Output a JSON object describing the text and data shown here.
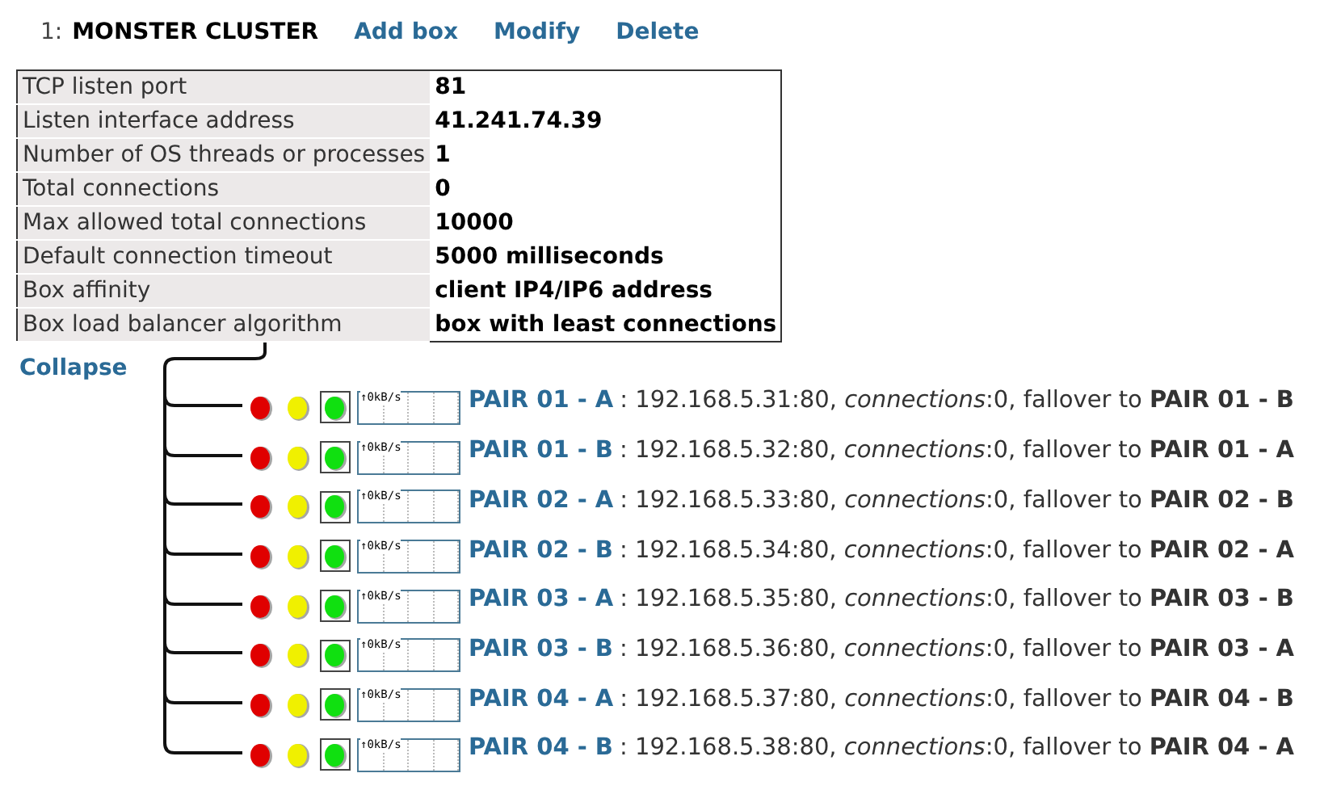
{
  "cluster": {
    "index": "1:",
    "name": "MONSTER CLUSTER",
    "actions": [
      "Add box",
      "Modify",
      "Delete"
    ]
  },
  "properties": [
    {
      "label": "TCP listen port",
      "value": "81"
    },
    {
      "label": "Listen interface address",
      "value": "41.241.74.39"
    },
    {
      "label": "Number of OS threads or processes",
      "value": "1"
    },
    {
      "label": "Total connections",
      "value": "0"
    },
    {
      "label": "Max allowed total connections",
      "value": "10000"
    },
    {
      "label": "Default connection timeout",
      "value": "5000 milliseconds"
    },
    {
      "label": "Box affinity",
      "value": "client IP4/IP6 address"
    },
    {
      "label": "Box load balancer algorithm",
      "value": "box with least connections"
    }
  ],
  "collapse": "Collapse",
  "boxes": [
    {
      "name": "PAIR 01 - A",
      "rate": "↑0kB/s",
      "lights": [
        {
          "color": "#e00000",
          "selected": false
        },
        {
          "color": "#f0f000",
          "selected": false
        },
        {
          "color": "#10e010",
          "selected": true
        }
      ],
      "detail": ": 192.168.5.31:80, *connections*:0, fallover to **PAIR 01 - B**"
    },
    {
      "name": "PAIR 01 - B",
      "rate": "↑0kB/s",
      "lights": [
        {
          "color": "#e00000",
          "selected": false
        },
        {
          "color": "#f0f000",
          "selected": false
        },
        {
          "color": "#10e010",
          "selected": true
        }
      ],
      "detail": ": 192.168.5.32:80, *connections*:0, fallover to **PAIR 01 - A**"
    },
    {
      "name": "PAIR 02 - A",
      "rate": "↑0kB/s",
      "lights": [
        {
          "color": "#e00000",
          "selected": false
        },
        {
          "color": "#f0f000",
          "selected": false
        },
        {
          "color": "#10e010",
          "selected": true
        }
      ],
      "detail": ": 192.168.5.33:80, *connections*:0, fallover to **PAIR 02 - B**"
    },
    {
      "name": "PAIR 02 - B",
      "rate": "↑0kB/s",
      "lights": [
        {
          "color": "#e00000",
          "selected": false
        },
        {
          "color": "#f0f000",
          "selected": false
        },
        {
          "color": "#10e010",
          "selected": true
        }
      ],
      "detail": ": 192.168.5.34:80, *connections*:0, fallover to **PAIR 02 - A**"
    },
    {
      "name": "PAIR 03 - A",
      "rate": "↑0kB/s",
      "lights": [
        {
          "color": "#e00000",
          "selected": false
        },
        {
          "color": "#f0f000",
          "selected": false
        },
        {
          "color": "#10e010",
          "selected": true
        }
      ],
      "detail": ": 192.168.5.35:80, *connections*:0, fallover to **PAIR 03 - B**"
    },
    {
      "name": "PAIR 03 - B",
      "rate": "↑0kB/s",
      "lights": [
        {
          "color": "#e00000",
          "selected": false
        },
        {
          "color": "#f0f000",
          "selected": false
        },
        {
          "color": "#10e010",
          "selected": true
        }
      ],
      "detail": ": 192.168.5.36:80, *connections*:0, fallover to **PAIR 03 - A**"
    },
    {
      "name": "PAIR 04 - A",
      "rate": "↑0kB/s",
      "lights": [
        {
          "color": "#e00000",
          "selected": false
        },
        {
          "color": "#f0f000",
          "selected": false
        },
        {
          "color": "#10e010",
          "selected": true
        }
      ],
      "detail": ": 192.168.5.37:80, *connections*:0, fallover to **PAIR 04 - B**"
    },
    {
      "name": "PAIR 04 - B",
      "rate": "↑0kB/s",
      "lights": [
        {
          "color": "#e00000",
          "selected": false
        },
        {
          "color": "#f0f000",
          "selected": false
        },
        {
          "color": "#10e010",
          "selected": true
        }
      ],
      "detail": ": 192.168.5.38:80, *connections*:0, fallover to **PAIR 04 - A**"
    }
  ]
}
